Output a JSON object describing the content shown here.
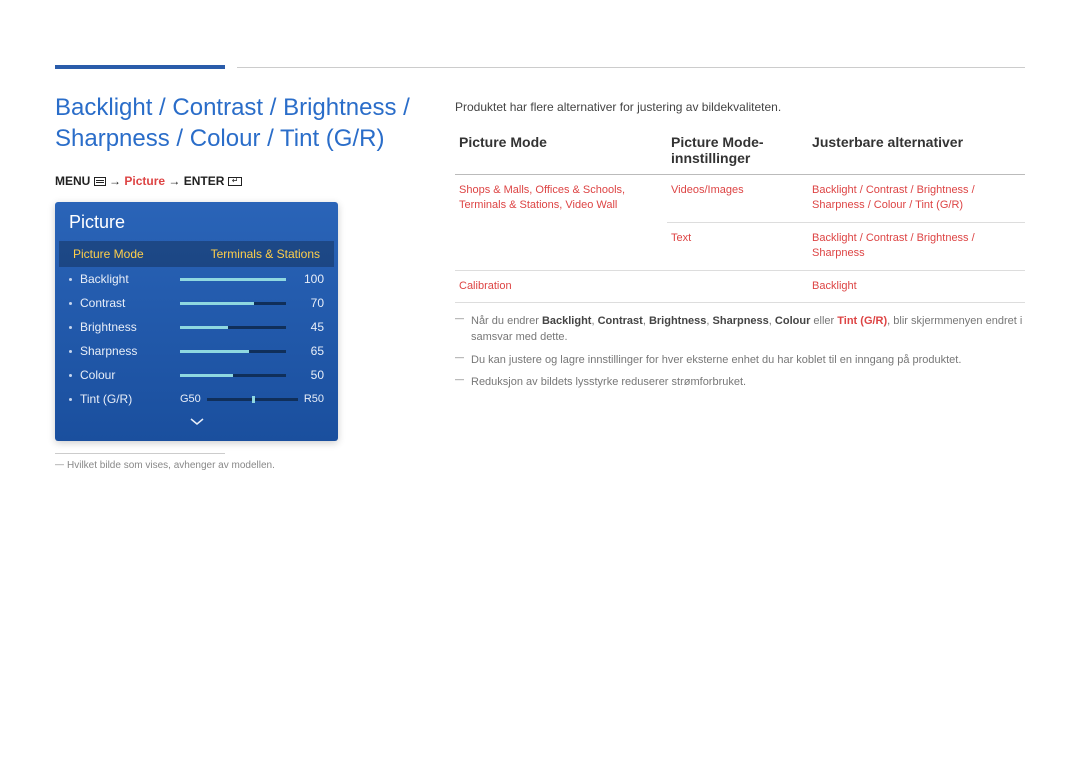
{
  "main_title": "Backlight / Contrast / Brightness / Sharpness / Colour / Tint (G/R)",
  "nav": {
    "menu": "MENU",
    "arrow": " → ",
    "picture": "Picture",
    "enter": "ENTER"
  },
  "osd": {
    "title": "Picture",
    "mode_label": "Picture Mode",
    "mode_value": "Terminals & Stations",
    "rows": [
      {
        "label": "Backlight",
        "value": 100,
        "pct": 100
      },
      {
        "label": "Contrast",
        "value": 70,
        "pct": 70
      },
      {
        "label": "Brightness",
        "value": 45,
        "pct": 45
      },
      {
        "label": "Sharpness",
        "value": 65,
        "pct": 65
      },
      {
        "label": "Colour",
        "value": 50,
        "pct": 50
      }
    ],
    "tint": {
      "label": "Tint (G/R)",
      "g": "G50",
      "r": "R50",
      "pos": 50
    }
  },
  "left_footnote": "Hvilket bilde som vises, avhenger av modellen.",
  "right": {
    "intro": "Produktet har flere alternativer for justering av bildekvaliteten.",
    "headers": [
      "Picture Mode",
      "Picture Mode-innstillinger",
      "Justerbare alternativer"
    ],
    "rows": [
      {
        "c1": "Shops & Malls, Offices & Schools, Terminals & Stations, Video Wall",
        "c2": "Videos/Images",
        "c3": "Backlight / Contrast / Brightness / Sharpness / Colour / Tint (G/R)"
      },
      {
        "c1": "",
        "c2": "Text",
        "c3": "Backlight / Contrast / Brightness / Sharpness"
      },
      {
        "c1": "Calibration",
        "c2": "",
        "c3": "Backlight"
      }
    ],
    "notes": {
      "n1a": "Når du endrer ",
      "n1b_list": [
        "Backlight",
        "Contrast",
        "Brightness",
        "Sharpness",
        "Colour"
      ],
      "n1c": " eller ",
      "n1d": "Tint (G/R)",
      "n1e": ", blir skjermmenyen endret i samsvar med dette.",
      "n2": "Du kan justere og lagre innstillinger for hver eksterne enhet du har koblet til en inngang på produktet.",
      "n3": "Reduksjon av bildets lysstyrke reduserer strømforbruket."
    }
  }
}
